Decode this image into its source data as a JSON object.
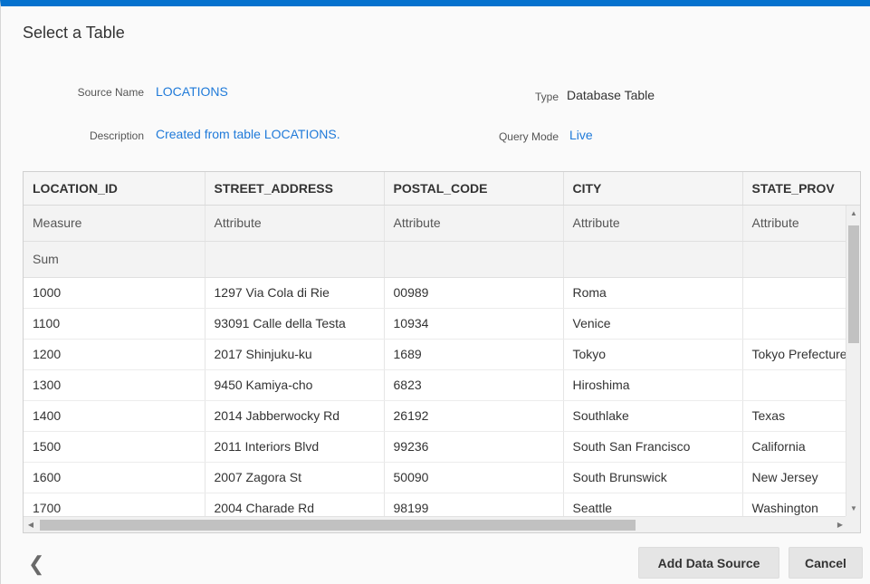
{
  "dialog": {
    "title": "Select a Table"
  },
  "properties": {
    "source_name_label": "Source Name",
    "source_name_value": "LOCATIONS",
    "type_label": "Type",
    "type_value": "Database Table",
    "description_label": "Description",
    "description_value": "Created from table LOCATIONS.",
    "query_mode_label": "Query Mode",
    "query_mode_value": "Live"
  },
  "table": {
    "columns": [
      "LOCATION_ID",
      "STREET_ADDRESS",
      "POSTAL_CODE",
      "CITY",
      "STATE_PROV"
    ],
    "types": [
      "Measure",
      "Attribute",
      "Attribute",
      "Attribute",
      "Attribute"
    ],
    "aggregations": [
      "Sum",
      "",
      "",
      "",
      ""
    ],
    "rows": [
      [
        "1000",
        "1297 Via Cola di Rie",
        "00989",
        "Roma",
        ""
      ],
      [
        "1100",
        "93091 Calle della Testa",
        "10934",
        "Venice",
        ""
      ],
      [
        "1200",
        "2017 Shinjuku-ku",
        "1689",
        "Tokyo",
        "Tokyo Prefecture"
      ],
      [
        "1300",
        "9450 Kamiya-cho",
        "6823",
        "Hiroshima",
        ""
      ],
      [
        "1400",
        "2014 Jabberwocky Rd",
        "26192",
        "Southlake",
        "Texas"
      ],
      [
        "1500",
        "2011 Interiors Blvd",
        "99236",
        "South San Francisco",
        "California"
      ],
      [
        "1600",
        "2007 Zagora St",
        "50090",
        "South Brunswick",
        "New Jersey"
      ],
      [
        "1700",
        "2004 Charade Rd",
        "98199",
        "Seattle",
        "Washington"
      ]
    ]
  },
  "footer": {
    "back_icon": "chevron-left-icon",
    "back_glyph": "❮",
    "add_button": "Add Data Source",
    "cancel_button": "Cancel"
  },
  "scroll_glyphs": {
    "up": "▲",
    "down": "▼",
    "left": "◀",
    "right": "▶"
  },
  "colors": {
    "accent": "#0572ce",
    "link": "#1f7ad9"
  }
}
